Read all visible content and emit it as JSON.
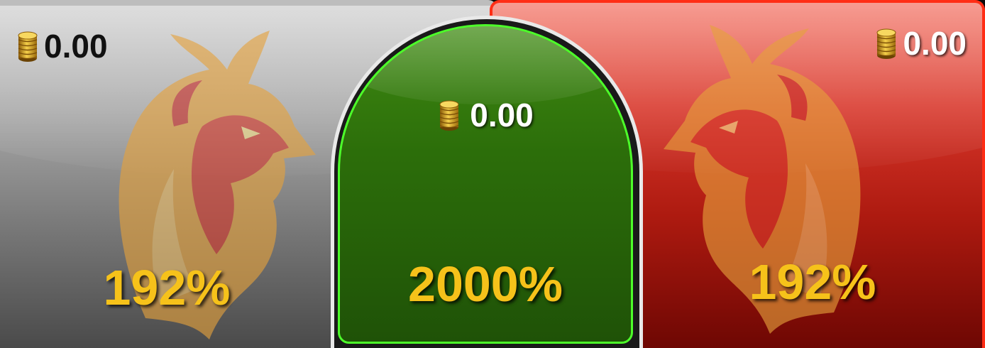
{
  "bets": {
    "left": {
      "stake": "0.00",
      "odds": "192%",
      "color": "#9a9a9a",
      "icon": "rooster-icon"
    },
    "draw": {
      "stake": "0.00",
      "odds": "2000%",
      "color": "#2c6e0a",
      "icon": "coin-stack-icon"
    },
    "right": {
      "stake": "0.00",
      "odds": "192%",
      "color": "#c1241a",
      "icon": "rooster-icon"
    }
  },
  "colors": {
    "odds_text": "#f6c21a",
    "draw_border": "#4dff2a",
    "right_border": "#ff2d15",
    "coin": "#d9a21c"
  }
}
